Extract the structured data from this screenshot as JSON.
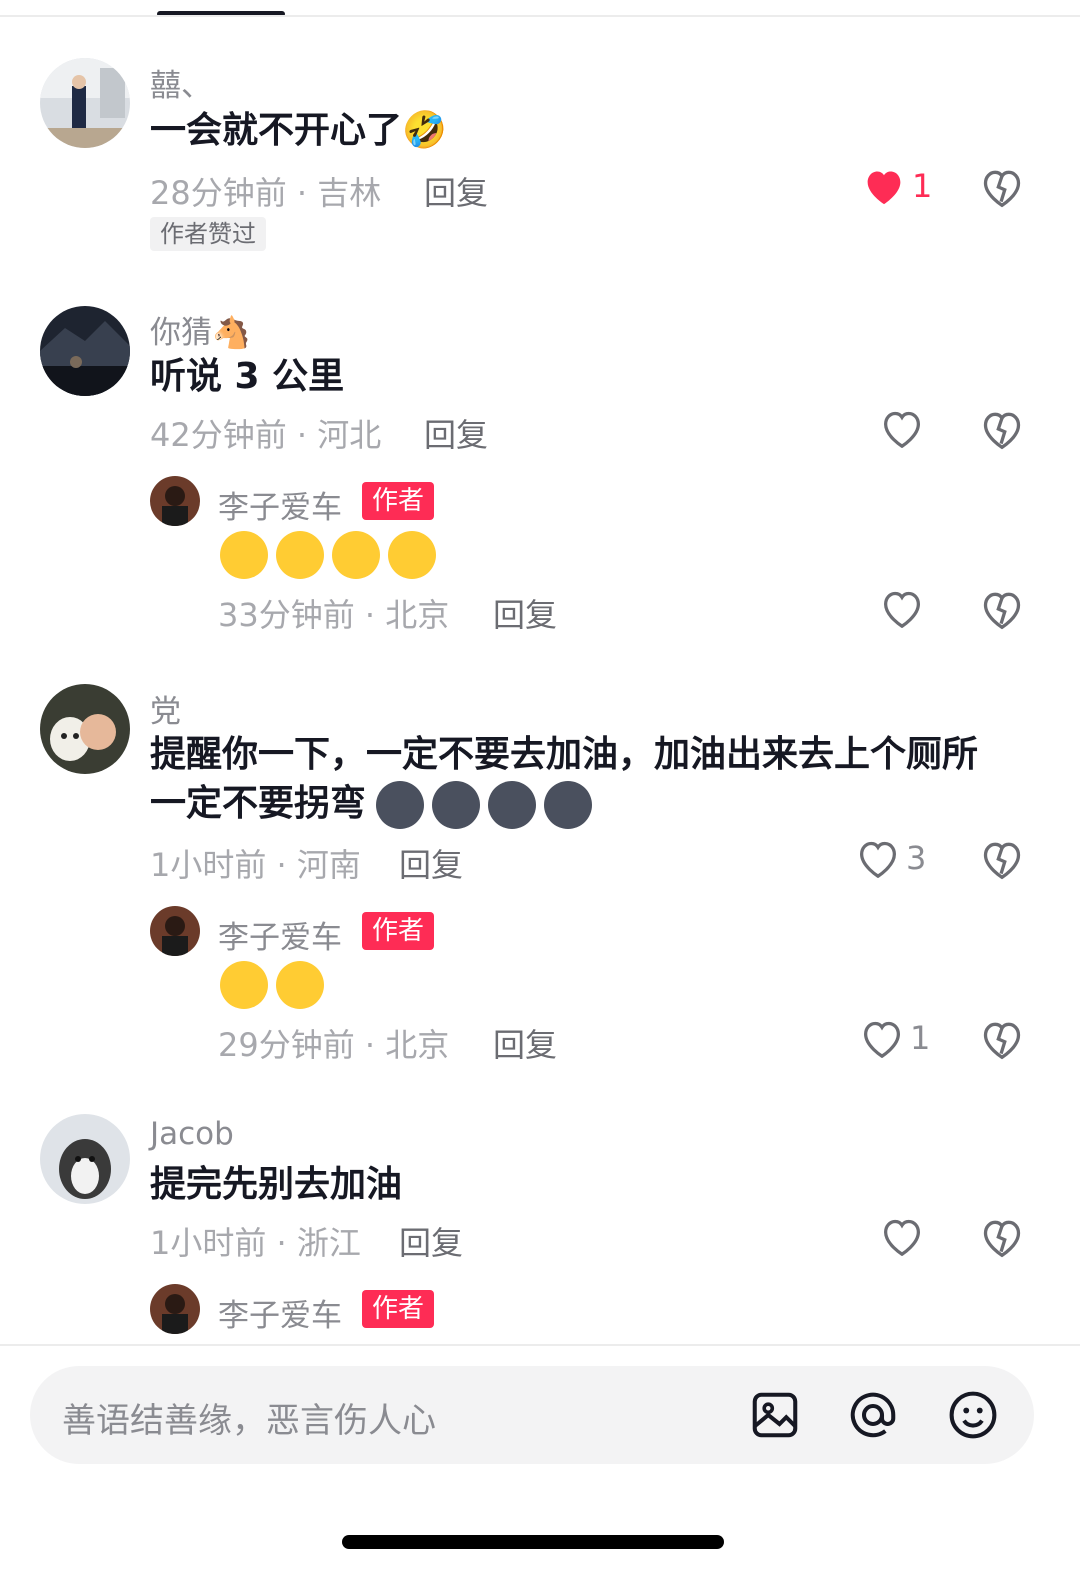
{
  "comments": [
    {
      "user": "囍、",
      "text": "一会就不开心了🤣",
      "time": "28分钟前 · 吉林",
      "reply": "回复",
      "likes": "1",
      "liked": true,
      "badge": "作者赞过"
    },
    {
      "user": "你猜🐴",
      "text": "听说 3 公里",
      "time": "42分钟前 · 河北",
      "reply": "回复",
      "likes": "",
      "liked": false,
      "sub_reply": {
        "user": "李子爱车",
        "tag": "作者",
        "emoji": [
          "crying-hands-emoji",
          "crying-hands-emoji",
          "crying-hands-emoji",
          "crying-hands-emoji"
        ],
        "time": "33分钟前 · 北京",
        "reply": "回复",
        "likes": ""
      }
    },
    {
      "user": "党",
      "text": "提醒你一下，一定不要去加油，加油出来去上个厕所",
      "text2": "一定不要拐弯",
      "emoji": [
        "husky-dog-emoji",
        "husky-dog-emoji",
        "husky-dog-emoji",
        "husky-dog-emoji"
      ],
      "time": "1小时前 · 河南",
      "reply": "回复",
      "likes": "3",
      "liked": false,
      "sub_reply": {
        "user": "李子爱车",
        "tag": "作者",
        "emoji": [
          "crying-hands-emoji",
          "crying-hands-emoji"
        ],
        "time": "29分钟前 · 北京",
        "reply": "回复",
        "likes": "1"
      }
    },
    {
      "user": "Jacob",
      "text": "提完先别去加油",
      "time": "1小时前 · 浙江",
      "reply": "回复",
      "likes": "",
      "liked": false,
      "sub_reply": {
        "user": "李子爱车",
        "tag": "作者"
      }
    }
  ],
  "input_bar": {
    "placeholder": "善语结善缘，恶言伤人心",
    "icons": [
      "image-icon",
      "at-icon",
      "emoji-icon"
    ]
  },
  "colors": {
    "accent": "#fe2c55",
    "text": "#161823",
    "muted": "#a7a8ad"
  }
}
